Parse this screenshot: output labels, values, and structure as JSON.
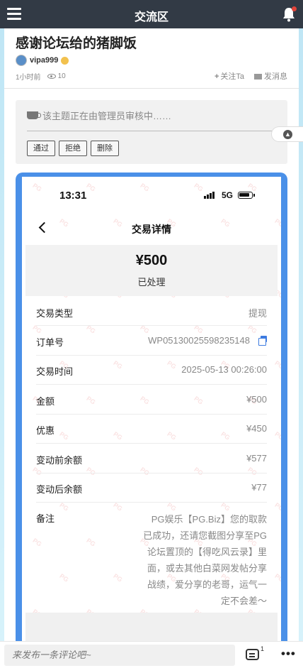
{
  "header": {
    "title": "交流区"
  },
  "post": {
    "title": "感谢论坛给的猪脚饭",
    "author": "vipa999",
    "time": "1小时前",
    "views": "10",
    "follow_label": "关注Ta",
    "message_label": "发消息"
  },
  "review": {
    "notice": "该主题正在由管理员审核中……",
    "approve": "通过",
    "reject": "拒绝",
    "delete": "删除"
  },
  "screenshot": {
    "status_time": "13:31",
    "network": "5G",
    "nav_title": "交易详情",
    "amount": "¥500",
    "status": "已处理",
    "watermark": "PG",
    "rows": [
      {
        "label": "交易类型",
        "value": "提现"
      },
      {
        "label": "订单号",
        "value": "WP05130025598235148"
      },
      {
        "label": "交易时间",
        "value": "2025-05-13 00:26:00"
      },
      {
        "label": "金额",
        "value": "¥500"
      },
      {
        "label": "优惠",
        "value": "¥450"
      },
      {
        "label": "变动前余额",
        "value": "¥577"
      },
      {
        "label": "变动后余额",
        "value": "¥77"
      },
      {
        "label": "备注",
        "value": "PG娱乐【PG.Biz】您的取款已成功，还请您截图分享至PG论坛置顶的【得吃风云录】里面，或去其他白菜网发帖分享战绩，爱分享的老哥，运气一定不会差～"
      }
    ]
  },
  "bottombar": {
    "comment_placeholder": "来发布一条评论吧~",
    "comment_count": "1",
    "more": "•••"
  },
  "icons": [
    "menu-icon",
    "bell-icon",
    "eye-icon",
    "plus-icon",
    "envelope-icon",
    "coffee-cup-icon",
    "arrow-up-circle-icon",
    "back-chevron-icon",
    "copy-icon",
    "comment-icon",
    "more-icon"
  ]
}
